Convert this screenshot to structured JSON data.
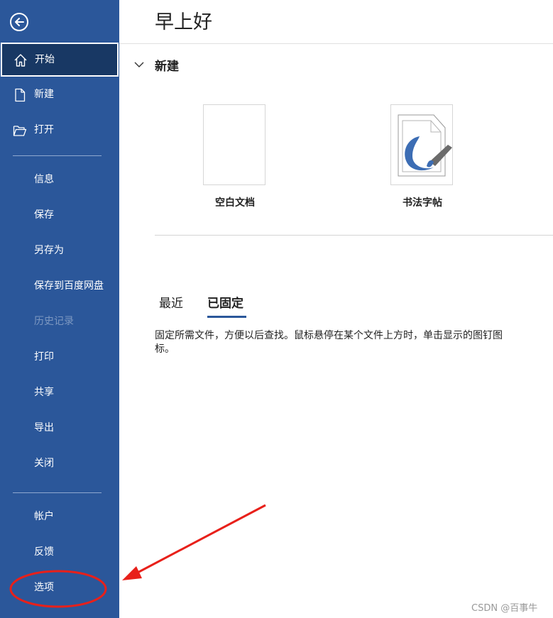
{
  "sidebar": {
    "items": [
      {
        "label": "开始",
        "icon": "home-icon"
      },
      {
        "label": "新建",
        "icon": "new-document-icon"
      },
      {
        "label": "打开",
        "icon": "open-folder-icon"
      },
      {
        "label": "信息"
      },
      {
        "label": "保存"
      },
      {
        "label": "另存为"
      },
      {
        "label": "保存到百度网盘"
      },
      {
        "label": "历史记录"
      },
      {
        "label": "打印"
      },
      {
        "label": "共享"
      },
      {
        "label": "导出"
      },
      {
        "label": "关闭"
      },
      {
        "label": "帐户"
      },
      {
        "label": "反馈"
      },
      {
        "label": "选项"
      }
    ]
  },
  "main": {
    "greeting": "早上好",
    "new_section": {
      "title": "新建",
      "templates": [
        {
          "label": "空白文档"
        },
        {
          "label": "书法字帖"
        }
      ]
    },
    "tabs": [
      {
        "label": "最近"
      },
      {
        "label": "已固定"
      }
    ],
    "pinned_hint": "固定所需文件，方便以后查找。鼠标悬停在某个文件上方时，单击显示的图钉图标。"
  },
  "watermark": "CSDN @百事牛",
  "colors": {
    "sidebar_bg": "#2b579a",
    "active_bg": "#183864",
    "annotation_red": "#e8201a"
  }
}
